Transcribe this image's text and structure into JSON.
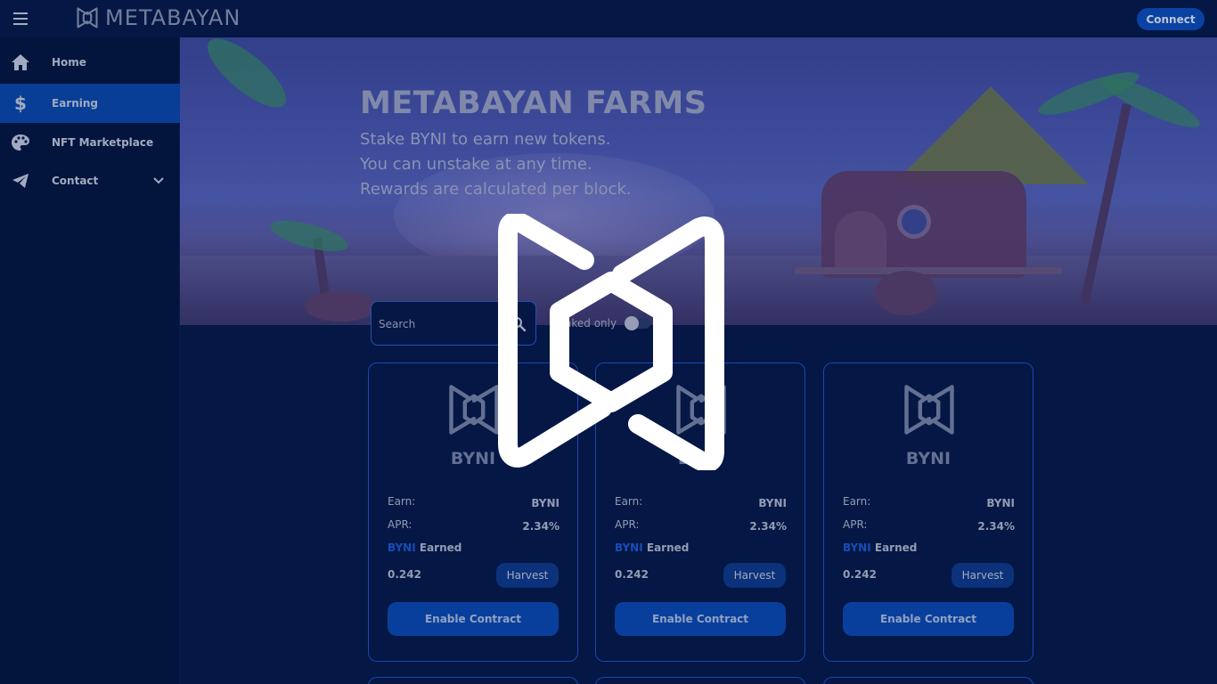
{
  "header": {
    "brand": "METABAYAN",
    "connect_label": "Connect"
  },
  "sidebar": {
    "items": [
      {
        "label": "Home",
        "icon": "home-icon"
      },
      {
        "label": "Earning",
        "icon": "dollar-icon"
      },
      {
        "label": "NFT Marketplace",
        "icon": "palette-icon"
      },
      {
        "label": "Contact",
        "icon": "paper-plane-icon"
      }
    ],
    "active_index": 1
  },
  "hero": {
    "title": "METABAYAN FARMS",
    "lines": [
      "Stake BYNI to earn new tokens.",
      "You can unstake at any time.",
      "Rewards are calculated per block."
    ]
  },
  "filters": {
    "search_placeholder": "Search",
    "toggle_label": "Staked only",
    "toggle_visible_label": "aked only",
    "staked_only": false
  },
  "cards": [
    {
      "token": "BYNI",
      "earn_label": "Earn:",
      "earn_value": "BYNI",
      "apr_label": "APR:",
      "apr_value": "2.34%",
      "earned_token": "BYNI",
      "earned_word": "Earned",
      "earned_amount": "0.242",
      "harvest_label": "Harvest",
      "enable_label": "Enable Contract"
    },
    {
      "token": "BYNI",
      "earn_label": "Earn:",
      "earn_value": "BYNI",
      "apr_label": "APR:",
      "apr_value": "2.34%",
      "earned_token": "BYNI",
      "earned_word": "Earned",
      "earned_amount": "0.242",
      "harvest_label": "Harvest",
      "enable_label": "Enable Contract"
    },
    {
      "token": "BYNI",
      "earn_label": "Earn:",
      "earn_value": "BYNI",
      "apr_label": "APR:",
      "apr_value": "2.34%",
      "earned_token": "BYNI",
      "earned_word": "Earned",
      "earned_amount": "0.242",
      "harvest_label": "Harvest",
      "enable_label": "Enable Contract"
    }
  ],
  "colors": {
    "background": "#061a4d",
    "accent": "#0b4fbf",
    "card_border": "#1e56d1",
    "token_highlight": "#1d5cd8"
  }
}
